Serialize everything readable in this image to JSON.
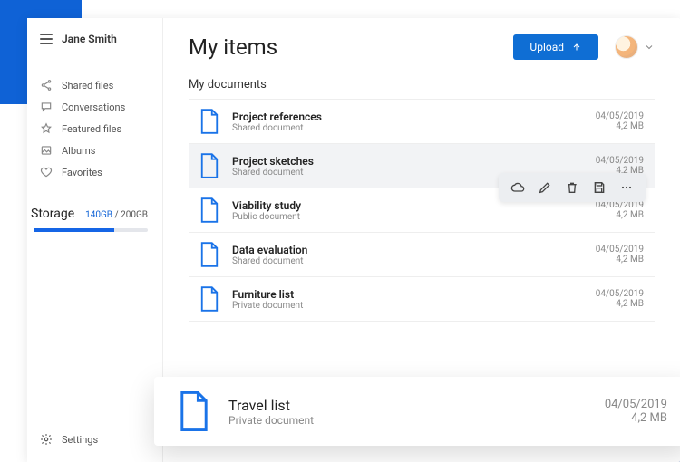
{
  "user": {
    "name": "Jane Smith"
  },
  "sidebar": {
    "items": [
      {
        "label": "Shared files"
      },
      {
        "label": "Conversations"
      },
      {
        "label": "Featured files"
      },
      {
        "label": "Albums"
      },
      {
        "label": "Favorites"
      }
    ],
    "storage": {
      "title": "Storage",
      "used": "140GB",
      "sep": " / ",
      "total": "200GB",
      "used_fraction": 0.7
    },
    "settings_label": "Settings"
  },
  "header": {
    "title": "My items",
    "upload_label": "Upload"
  },
  "section_title": "My documents",
  "documents": [
    {
      "name": "Project references",
      "sub": "Shared document",
      "date": "04/05/2019",
      "size": "4,2 MB"
    },
    {
      "name": "Project sketches",
      "sub": "Shared document",
      "date": "04/05/2019",
      "size": "4,2 MB"
    },
    {
      "name": "Viability study",
      "sub": "Public document",
      "date": "04/05/2019",
      "size": "4,2 MB"
    },
    {
      "name": "Data evaluation",
      "sub": "Shared document",
      "date": "04/05/2019",
      "size": "4,2 MB"
    },
    {
      "name": "Furniture list",
      "sub": "Private document",
      "date": "04/05/2019",
      "size": "4,2 MB"
    }
  ],
  "detached": {
    "name": "Travel list",
    "sub": "Private document",
    "date": "04/05/2019",
    "size": "4,2 MB"
  }
}
